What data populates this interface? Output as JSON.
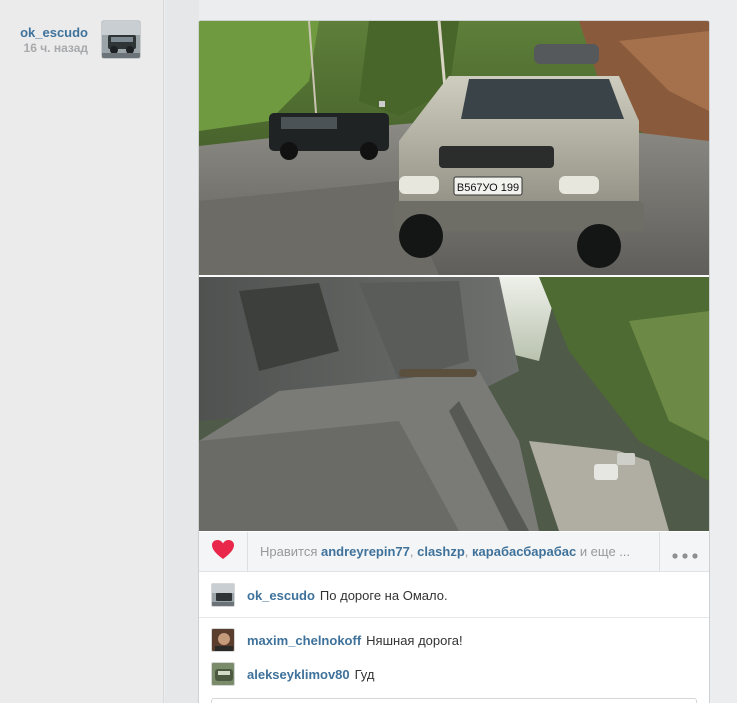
{
  "post": {
    "author": {
      "username": "ok_escudo",
      "time": "16 ч. назад"
    },
    "likes": {
      "prefix": "Нравится",
      "users": [
        "andreyrepin77",
        "clashzp",
        "карабасбарабас"
      ],
      "suffix": "и еще ..."
    },
    "caption": {
      "username": "ok_escudo",
      "text": "По дороге на Омало."
    },
    "comments": [
      {
        "username": "maxim_chelnokoff",
        "text": "Няшная дорога!"
      },
      {
        "username": "alekseyklimov80",
        "text": "Гуд"
      }
    ],
    "photo": {
      "top_plate": "B567УО 199",
      "description_icons": [
        "heart-icon",
        "more-icon"
      ]
    }
  },
  "colors": {
    "link": "#3f729b",
    "like": "#e8274b",
    "muted": "#999999"
  }
}
